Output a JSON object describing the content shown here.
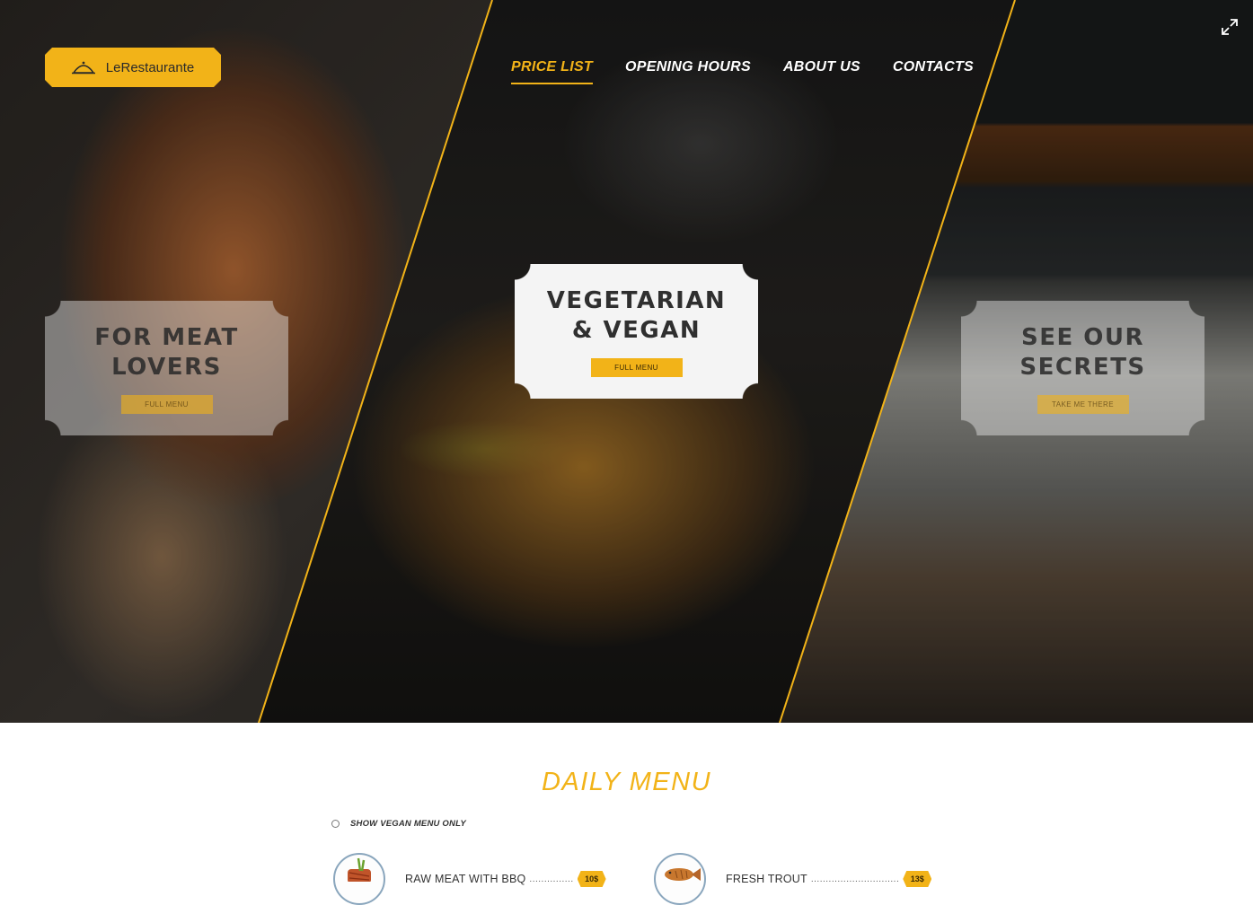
{
  "logo": {
    "text": "LeRestaurante",
    "icon": "cloche-icon"
  },
  "nav": {
    "items": [
      {
        "label": "PRICE LIST",
        "active": true
      },
      {
        "label": "OPENING HOURS",
        "active": false
      },
      {
        "label": "ABOUT US",
        "active": false
      },
      {
        "label": "CONTACTS",
        "active": false
      }
    ]
  },
  "fullscreen_icon": "expand-icon",
  "hero": {
    "panels": [
      {
        "title": "FOR MEAT\nLOVERS",
        "button": "FULL MENU",
        "style": "faded"
      },
      {
        "title": "VEGETARIAN\n& VEGAN",
        "button": "FULL MENU",
        "style": "solid"
      },
      {
        "title": "SEE OUR\nSECRETS",
        "button": "TAKE ME THERE",
        "style": "faded"
      }
    ]
  },
  "daily_menu": {
    "title": "DAILY MENU",
    "vegan_toggle": "SHOW VEGAN MENU ONLY",
    "items": [
      {
        "name": "RAW MEAT WITH BBQ",
        "dots": "...............",
        "price": "10$",
        "icon": "ribs-icon"
      },
      {
        "name": "FRESH TROUT",
        "dots": "..............................",
        "price": "13$",
        "icon": "fish-icon"
      }
    ]
  },
  "colors": {
    "accent": "#f2b318",
    "text_dark": "#2f2f2f",
    "thumb_border": "#8aa6bd"
  }
}
